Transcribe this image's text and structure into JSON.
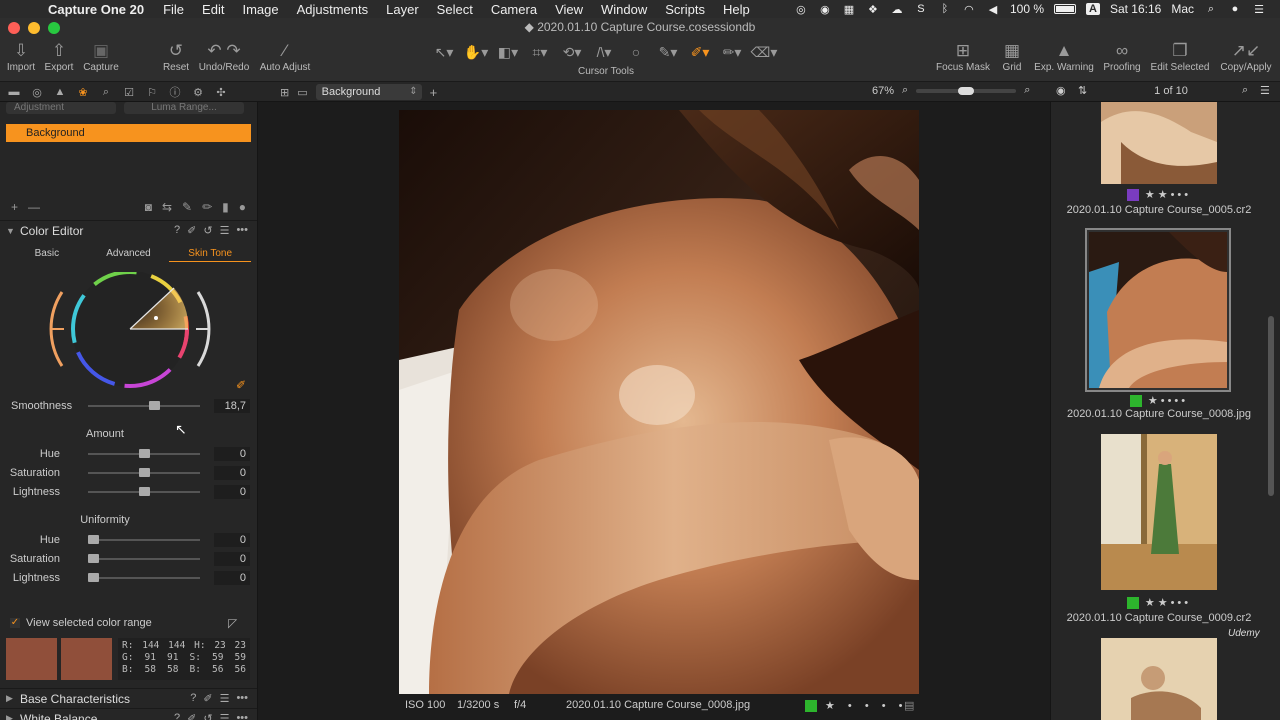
{
  "menubar": {
    "app_name": "Capture One 20",
    "items": [
      "File",
      "Edit",
      "Image",
      "Adjustments",
      "Layer",
      "Select",
      "Camera",
      "View",
      "Window",
      "Scripts",
      "Help"
    ],
    "battery": "100 %",
    "input_badge": "A",
    "clock": "Sat 16:16",
    "user": "Mac"
  },
  "window": {
    "title": "2020.01.10 Capture Course.cosessiondb"
  },
  "toolbar": {
    "import": "Import",
    "export": "Export",
    "capture": "Capture",
    "reset": "Reset",
    "undo_redo": "Undo/Redo",
    "auto_adjust": "Auto Adjust",
    "cursor_tools": "Cursor Tools",
    "focus_mask": "Focus Mask",
    "grid": "Grid",
    "exp_warning": "Exp. Warning",
    "proofing": "Proofing",
    "edit_selected": "Edit Selected",
    "copy_apply": "Copy/Apply"
  },
  "viewer_bar": {
    "layer_select": "Background",
    "zoom": "67%"
  },
  "browser_bar": {
    "count": "1 of 10"
  },
  "layers": {
    "adjustment": "Adjustment",
    "luma_range": "Luma Range...",
    "selected": "Background"
  },
  "color_editor": {
    "title": "Color Editor",
    "help": "?",
    "tabs": [
      "Basic",
      "Advanced",
      "Skin Tone"
    ],
    "active_tab": 2,
    "smoothness_label": "Smoothness",
    "smoothness_value": "18,7",
    "amount_label": "Amount",
    "amount": [
      {
        "label": "Hue",
        "value": "0",
        "pos": 0.5
      },
      {
        "label": "Saturation",
        "value": "0",
        "pos": 0.5
      },
      {
        "label": "Lightness",
        "value": "0",
        "pos": 0.5
      }
    ],
    "uniformity_label": "Uniformity",
    "uniformity": [
      {
        "label": "Hue",
        "value": "0",
        "pos": 0.0
      },
      {
        "label": "Saturation",
        "value": "0",
        "pos": 0.0
      },
      {
        "label": "Lightness",
        "value": "0",
        "pos": 0.0
      }
    ],
    "view_range_label": "View selected color range",
    "readout": [
      [
        "R:",
        "144",
        "144",
        "H:",
        "23",
        "23"
      ],
      [
        "G:",
        "91",
        "91",
        "S:",
        "59",
        "59"
      ],
      [
        "B:",
        "58",
        "58",
        "B:",
        "56",
        "56"
      ]
    ]
  },
  "next_tools": {
    "base_characteristics": "Base Characteristics",
    "white_balance": "White Balance"
  },
  "viewer_status": {
    "iso": "ISO 100",
    "shutter": "1/3200 s",
    "aperture": "f/4",
    "filename": "2020.01.10 Capture Course_0008.jpg"
  },
  "browser": {
    "items": [
      {
        "name": "2020.01.10 Capture Course_0005.cr2",
        "tag_color": "#7a3cc0",
        "rating": 2
      },
      {
        "name": "2020.01.10 Capture Course_0008.jpg",
        "tag_color": "#2db52d",
        "rating": 1
      },
      {
        "name": "2020.01.10 Capture Course_0009.cr2",
        "tag_color": "#2db52d",
        "rating": 2
      }
    ]
  },
  "watermark": "Udemy",
  "colors": {
    "accent": "#f7931e",
    "panel": "#262626",
    "viewer_bg": "#1c1c1c"
  }
}
